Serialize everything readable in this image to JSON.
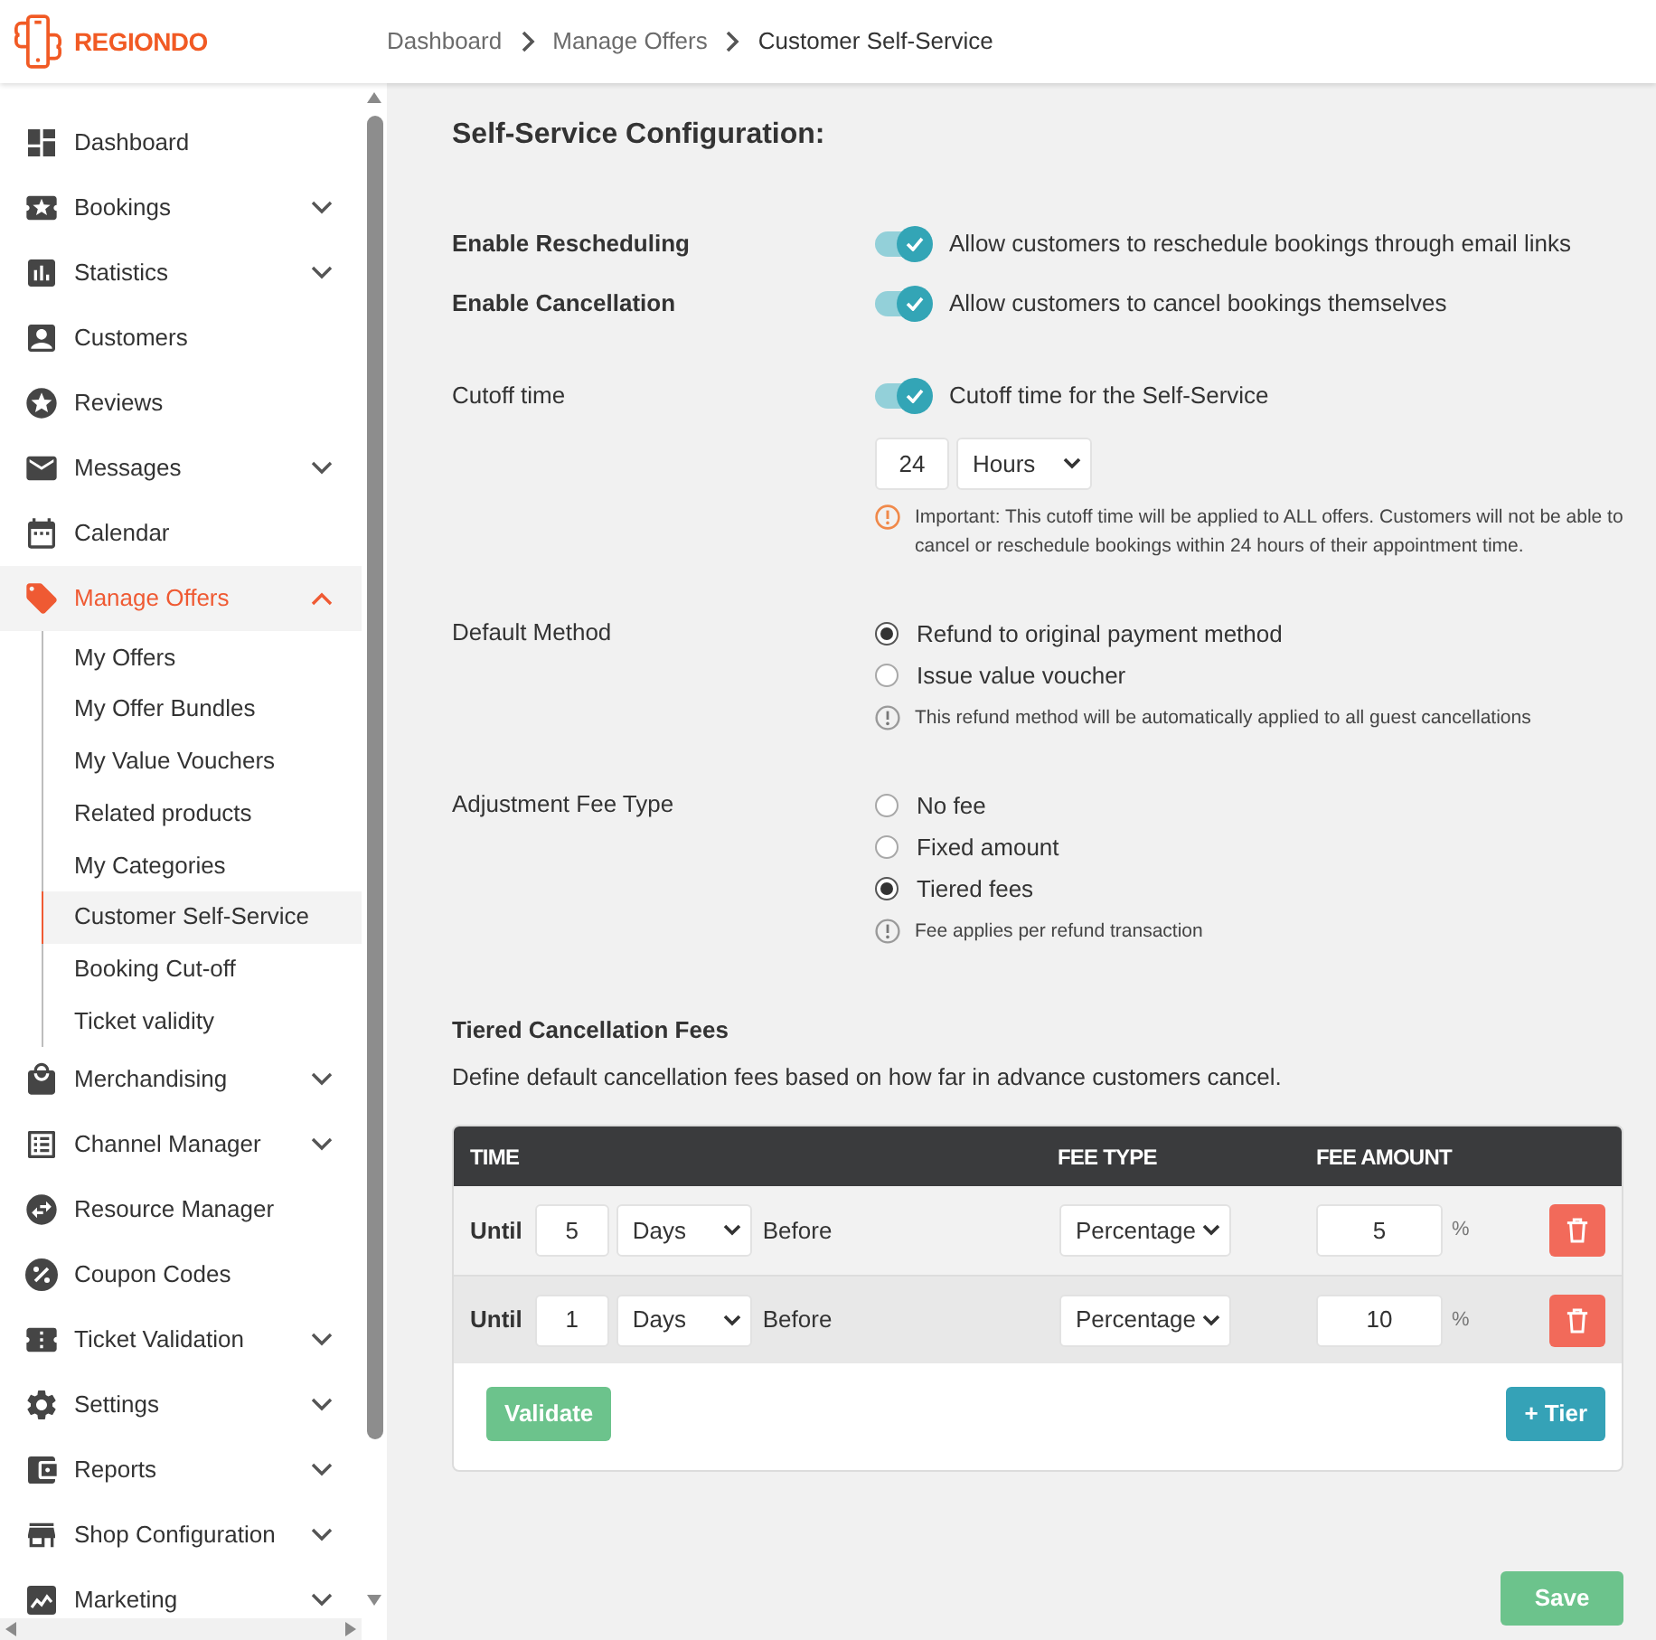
{
  "header": {
    "logo": "REGIONDO",
    "breadcrumbs": [
      {
        "label": "Dashboard",
        "current": false
      },
      {
        "label": "Manage Offers",
        "current": false
      },
      {
        "label": "Customer Self-Service",
        "current": true
      }
    ]
  },
  "sidebar": {
    "items": [
      {
        "kind": "link",
        "label": "Dashboard",
        "selected": false
      },
      {
        "kind": "group",
        "label": "Bookings",
        "selected": false,
        "expanded": false
      },
      {
        "kind": "group",
        "label": "Statistics",
        "selected": false,
        "expanded": false
      },
      {
        "kind": "link",
        "label": "Customers",
        "selected": false
      },
      {
        "kind": "link",
        "label": "Reviews",
        "selected": false
      },
      {
        "kind": "group",
        "label": "Messages",
        "selected": false,
        "expanded": false
      },
      {
        "kind": "link",
        "label": "Calendar",
        "selected": false
      },
      {
        "kind": "group",
        "label": "Manage Offers",
        "selected": true,
        "expanded": true,
        "children": [
          {
            "label": "My Offers",
            "selected": false
          },
          {
            "label": "My Offer Bundles",
            "selected": false
          },
          {
            "label": "My Value Vouchers",
            "selected": false
          },
          {
            "label": "Related products",
            "selected": false
          },
          {
            "label": "My Categories",
            "selected": false
          },
          {
            "label": "Customer Self-Service",
            "selected": true
          },
          {
            "label": "Booking Cut-off",
            "selected": false
          },
          {
            "label": "Ticket validity",
            "selected": false
          }
        ]
      },
      {
        "kind": "group",
        "label": "Merchandising",
        "selected": false,
        "expanded": false
      },
      {
        "kind": "group",
        "label": "Channel Manager",
        "selected": false,
        "expanded": false
      },
      {
        "kind": "link",
        "label": "Resource Manager",
        "selected": false
      },
      {
        "kind": "link",
        "label": "Coupon Codes",
        "selected": false
      },
      {
        "kind": "group",
        "label": "Ticket Validation",
        "selected": false,
        "expanded": false
      },
      {
        "kind": "group",
        "label": "Settings",
        "selected": false,
        "expanded": false
      },
      {
        "kind": "group",
        "label": "Reports",
        "selected": false,
        "expanded": false
      },
      {
        "kind": "group",
        "label": "Shop Configuration",
        "selected": false,
        "expanded": false
      },
      {
        "kind": "group",
        "label": "Marketing",
        "selected": false,
        "expanded": false
      }
    ]
  },
  "page": {
    "title": "Self-Service Configuration:",
    "sections": [
      {
        "rows": [
          {
            "kind": "toggle",
            "label": "Enable Rescheduling",
            "bold": true,
            "on": true,
            "text": "Allow customers to reschedule bookings through email links"
          },
          {
            "kind": "toggle",
            "label": "Enable Cancellation",
            "bold": true,
            "on": true,
            "text": "Allow customers to cancel bookings themselves"
          }
        ]
      },
      {
        "rows": [
          {
            "kind": "toggle",
            "label": "Cutoff time",
            "bold": false,
            "on": true,
            "text": "Cutoff time for the Self-Service",
            "amount": "24",
            "unit": "Hours",
            "note": {
              "kind": "warning",
              "text": "Important: This cutoff time will be applied to ALL offers. Customers will not be able to cancel or reschedule bookings within 24 hours of their appointment time."
            }
          }
        ]
      },
      {
        "rows": [
          {
            "kind": "radio",
            "label": "Default Method",
            "bold": false,
            "options": [
              {
                "label": "Refund to original payment method",
                "selected": true
              },
              {
                "label": "Issue value voucher",
                "selected": false
              }
            ],
            "note": {
              "kind": "info",
              "text": "This refund method will be automatically applied to all guest cancellations"
            }
          }
        ]
      },
      {
        "rows": [
          {
            "kind": "radio",
            "label": "Adjustment Fee Type",
            "bold": false,
            "options": [
              {
                "label": "No fee",
                "selected": false
              },
              {
                "label": "Fixed amount",
                "selected": false
              },
              {
                "label": "Tiered fees",
                "selected": true
              }
            ],
            "note": {
              "kind": "info",
              "text": "Fee applies per refund transaction"
            }
          }
        ]
      }
    ]
  },
  "fees": {
    "title": "Tiered Cancellation Fees",
    "description": "Define default cancellation fees based on how far in advance customers cancel.",
    "columns": [
      "TIME",
      "FEE TYPE",
      "FEE AMOUNT"
    ],
    "rows": [
      {
        "prefix": "Until",
        "amount": "5",
        "unit": "Days",
        "suffix": "Before",
        "fee_type": "Percentage",
        "fee_amount": "5",
        "fee_unit": "%"
      },
      {
        "prefix": "Until",
        "amount": "1",
        "unit": "Days",
        "suffix": "Before",
        "fee_type": "Percentage",
        "fee_amount": "10",
        "fee_unit": "%"
      }
    ],
    "validate_button": "Validate",
    "add_button": "+ Tier"
  },
  "save_button": "Save"
}
